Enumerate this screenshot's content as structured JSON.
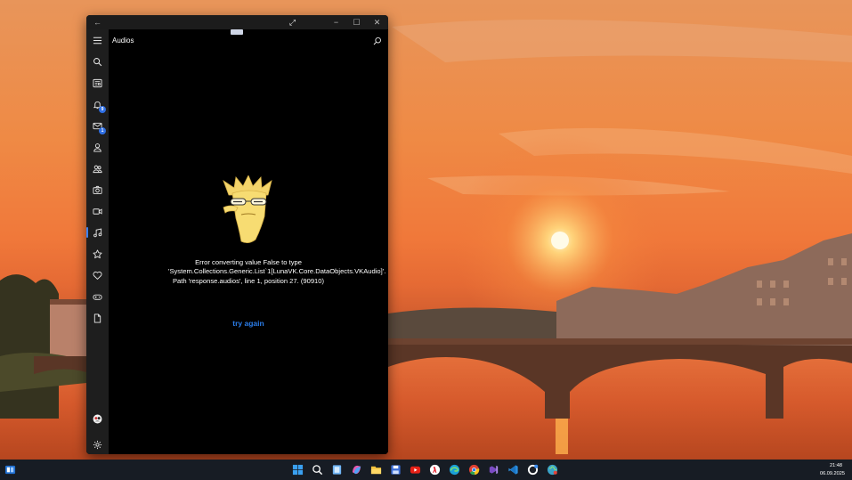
{
  "window": {
    "title_controls": {
      "back": "←",
      "expand": "⤢",
      "minimize": "−",
      "maximize": "☐",
      "close": "✕"
    }
  },
  "page": {
    "title": "Audios"
  },
  "sidebar": {
    "items": [
      {
        "name": "menu",
        "icon": "hamburger-menu-icon"
      },
      {
        "name": "search",
        "icon": "search-icon"
      },
      {
        "name": "news",
        "icon": "newspaper-icon"
      },
      {
        "name": "notifications",
        "icon": "bell-icon",
        "badge": "9"
      },
      {
        "name": "messages",
        "icon": "mail-icon",
        "badge": "1"
      },
      {
        "name": "profile",
        "icon": "person-icon"
      },
      {
        "name": "friends",
        "icon": "people-icon"
      },
      {
        "name": "photos",
        "icon": "camera-icon"
      },
      {
        "name": "videos",
        "icon": "video-icon"
      },
      {
        "name": "audios",
        "icon": "music-note-icon",
        "active": true
      },
      {
        "name": "bookmarks",
        "icon": "star-icon"
      },
      {
        "name": "favorites",
        "icon": "heart-icon"
      },
      {
        "name": "games",
        "icon": "gamepad-icon"
      },
      {
        "name": "documents",
        "icon": "document-icon"
      },
      {
        "name": "account",
        "icon": "avatar-icon"
      },
      {
        "name": "settings",
        "icon": "gear-icon"
      }
    ]
  },
  "error": {
    "message": "Error converting value False to type 'System.Collections.Generic.List`1[LunaVK.Core.DataObjects.VKAudio]'. Path 'response.audios', line 1, position 27. (90910)",
    "retry_label": "try again"
  },
  "taskbar": {
    "items": [
      "widgets-icon",
      "windows-start-icon",
      "search-icon",
      "task-view-icon",
      "copilot-icon",
      "file-explorer-icon",
      "save-app-icon",
      "youtube-icon",
      "yandex-browser-icon",
      "edge-icon",
      "chrome-icon",
      "visual-studio-icon",
      "vscode-icon",
      "vk-app-icon",
      "globe-app-icon"
    ],
    "time": "21:48",
    "date": "06.09.2025"
  },
  "colors": {
    "accent": "#2b7de9",
    "window_bg": "#000000",
    "sidebar_bg": "#1e1e1e",
    "taskbar_bg": "#171c24"
  }
}
